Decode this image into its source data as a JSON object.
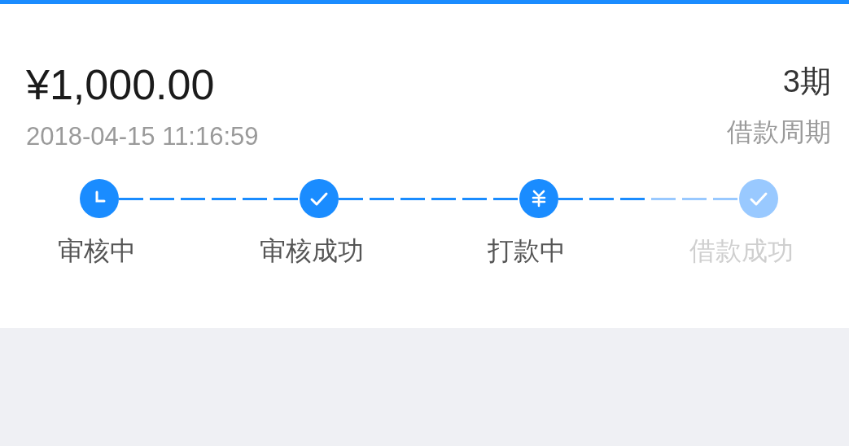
{
  "amount": "¥1,000.00",
  "time": "2018-04-15 11:16:59",
  "period": {
    "value": "3期",
    "label": "借款周期"
  },
  "steps": [
    {
      "kind": "clock",
      "label": "审核中",
      "done": true
    },
    {
      "kind": "check",
      "label": "审核成功",
      "done": true
    },
    {
      "kind": "yen",
      "label": "打款中",
      "done": true
    },
    {
      "kind": "check",
      "label": "借款成功",
      "done": false
    }
  ]
}
